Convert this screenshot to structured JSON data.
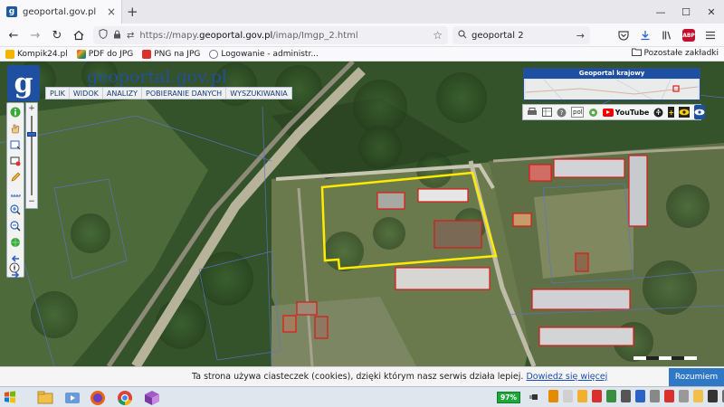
{
  "browser": {
    "tab_title": "geoportal.gov.pl",
    "tab_close_symbol": "×",
    "new_tab_symbol": "+",
    "window_buttons": [
      "—",
      "☐",
      "✕"
    ],
    "url_prefix": "https://mapy.",
    "url_domain": "geoportal.gov.pl",
    "url_path": "/imap/Imgp_2.html",
    "search_value": "geoportal 2",
    "abp_label": "ABP"
  },
  "bookmarks": {
    "items": [
      {
        "label": "Kompik24.pl",
        "color": "#f5b400"
      },
      {
        "label": "PDF do JPG",
        "color": "#d9302c"
      },
      {
        "label": "PNG na JPG",
        "color": "#d9302c"
      },
      {
        "label": "Logowanie - administr...",
        "color": "#6a7380"
      }
    ],
    "other_label": "Pozostałe zakładki"
  },
  "geoportal": {
    "logo_letter": "g",
    "logo_text": "geoportal.gov.pl",
    "menu": [
      "PLIK",
      "WIDOK",
      "ANALIZY",
      "POBIERANIE DANYCH",
      "WYSZUKIWANIA"
    ],
    "overview_title": "Geoportal krajowy",
    "language_value": "pol",
    "youtube_label": "YouTube"
  },
  "cookie_banner": {
    "text": "Ta strona używa ciasteczek (cookies), dzięki którym nasz serwis działa lepiej.",
    "link": "Dowiedz się więcej",
    "button": "Rozumiem"
  },
  "taskbar": {
    "battery_percent": "97%"
  },
  "colors": {
    "brand_blue": "#1f4fa0",
    "parcel_outline": "#ffea00",
    "building_outline": "#e01818",
    "cookie_button": "#2f78c6"
  }
}
